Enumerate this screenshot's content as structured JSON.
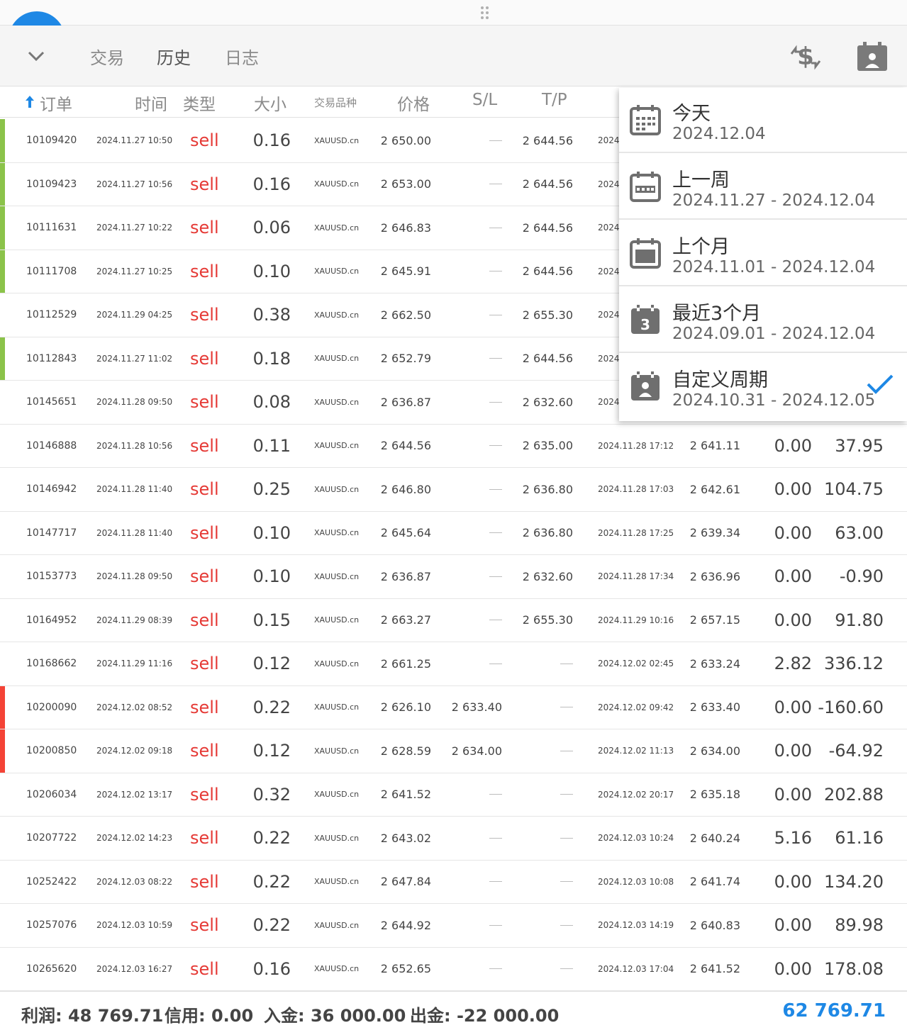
{
  "toolbar": {
    "tabs": [
      "交易",
      "历史",
      "日志"
    ],
    "active_tab": "历史",
    "icons": [
      "chevron-down-icon",
      "currency-exchange-icon",
      "calendar-user-icon"
    ]
  },
  "table": {
    "headers": [
      "订单",
      "时间",
      "类型",
      "大小",
      "交易品种",
      "价格",
      "S/L",
      "T/P"
    ],
    "rows": [
      {
        "order": "10109420",
        "time": "2024.11.27 10:50",
        "type": "sell",
        "size": "0.16",
        "symbol": "XAUUSD.cn",
        "price": "2 650.00",
        "sl": "",
        "tp": "2 644.56",
        "close_time": "2024",
        "close_price": "",
        "swap": "",
        "profit": "",
        "bar": "#8bc34a"
      },
      {
        "order": "10109423",
        "time": "2024.11.27 10:56",
        "type": "sell",
        "size": "0.16",
        "symbol": "XAUUSD.cn",
        "price": "2 653.00",
        "sl": "",
        "tp": "2 644.56",
        "close_time": "2024",
        "close_price": "",
        "swap": "",
        "profit": "",
        "bar": "#8bc34a"
      },
      {
        "order": "10111631",
        "time": "2024.11.27 10:22",
        "type": "sell",
        "size": "0.06",
        "symbol": "XAUUSD.cn",
        "price": "2 646.83",
        "sl": "",
        "tp": "2 644.56",
        "close_time": "2024",
        "close_price": "",
        "swap": "",
        "profit": "",
        "bar": "#8bc34a"
      },
      {
        "order": "10111708",
        "time": "2024.11.27 10:25",
        "type": "sell",
        "size": "0.10",
        "symbol": "XAUUSD.cn",
        "price": "2 645.91",
        "sl": "",
        "tp": "2 644.56",
        "close_time": "2024",
        "close_price": "",
        "swap": "",
        "profit": "",
        "bar": "#8bc34a"
      },
      {
        "order": "10112529",
        "time": "2024.11.29 04:25",
        "type": "sell",
        "size": "0.38",
        "symbol": "XAUUSD.cn",
        "price": "2 662.50",
        "sl": "",
        "tp": "2 655.30",
        "close_time": "2024",
        "close_price": "",
        "swap": "",
        "profit": "",
        "bar": ""
      },
      {
        "order": "10112843",
        "time": "2024.11.27 11:02",
        "type": "sell",
        "size": "0.18",
        "symbol": "XAUUSD.cn",
        "price": "2 652.79",
        "sl": "",
        "tp": "2 644.56",
        "close_time": "2024",
        "close_price": "",
        "swap": "",
        "profit": "",
        "bar": "#8bc34a"
      },
      {
        "order": "10145651",
        "time": "2024.11.28 09:50",
        "type": "sell",
        "size": "0.08",
        "symbol": "XAUUSD.cn",
        "price": "2 636.87",
        "sl": "",
        "tp": "2 632.60",
        "close_time": "2024",
        "close_price": "",
        "swap": "",
        "profit": "",
        "bar": ""
      },
      {
        "order": "10146888",
        "time": "2024.11.28 10:56",
        "type": "sell",
        "size": "0.11",
        "symbol": "XAUUSD.cn",
        "price": "2 644.56",
        "sl": "",
        "tp": "2 635.00",
        "close_time": "2024.11.28 17:12",
        "close_price": "2 641.11",
        "swap": "0.00",
        "profit": "37.95",
        "bar": ""
      },
      {
        "order": "10146942",
        "time": "2024.11.28 11:40",
        "type": "sell",
        "size": "0.25",
        "symbol": "XAUUSD.cn",
        "price": "2 646.80",
        "sl": "",
        "tp": "2 636.80",
        "close_time": "2024.11.28 17:03",
        "close_price": "2 642.61",
        "swap": "0.00",
        "profit": "104.75",
        "bar": ""
      },
      {
        "order": "10147717",
        "time": "2024.11.28 11:40",
        "type": "sell",
        "size": "0.10",
        "symbol": "XAUUSD.cn",
        "price": "2 645.64",
        "sl": "",
        "tp": "2 636.80",
        "close_time": "2024.11.28 17:25",
        "close_price": "2 639.34",
        "swap": "0.00",
        "profit": "63.00",
        "bar": ""
      },
      {
        "order": "10153773",
        "time": "2024.11.28 09:50",
        "type": "sell",
        "size": "0.10",
        "symbol": "XAUUSD.cn",
        "price": "2 636.87",
        "sl": "",
        "tp": "2 632.60",
        "close_time": "2024.11.28 17:34",
        "close_price": "2 636.96",
        "swap": "0.00",
        "profit": "-0.90",
        "bar": ""
      },
      {
        "order": "10164952",
        "time": "2024.11.29 08:39",
        "type": "sell",
        "size": "0.15",
        "symbol": "XAUUSD.cn",
        "price": "2 663.27",
        "sl": "",
        "tp": "2 655.30",
        "close_time": "2024.11.29 10:16",
        "close_price": "2 657.15",
        "swap": "0.00",
        "profit": "91.80",
        "bar": ""
      },
      {
        "order": "10168662",
        "time": "2024.11.29 11:16",
        "type": "sell",
        "size": "0.12",
        "symbol": "XAUUSD.cn",
        "price": "2 661.25",
        "sl": "",
        "tp": "",
        "close_time": "2024.12.02 02:45",
        "close_price": "2 633.24",
        "swap": "2.82",
        "profit": "336.12",
        "bar": ""
      },
      {
        "order": "10200090",
        "time": "2024.12.02 08:52",
        "type": "sell",
        "size": "0.22",
        "symbol": "XAUUSD.cn",
        "price": "2 626.10",
        "sl": "2 633.40",
        "tp": "",
        "close_time": "2024.12.02 09:42",
        "close_price": "2 633.40",
        "swap": "0.00",
        "profit": "-160.60",
        "bar": "#f44336"
      },
      {
        "order": "10200850",
        "time": "2024.12.02 09:18",
        "type": "sell",
        "size": "0.12",
        "symbol": "XAUUSD.cn",
        "price": "2 628.59",
        "sl": "2 634.00",
        "tp": "",
        "close_time": "2024.12.02 11:13",
        "close_price": "2 634.00",
        "swap": "0.00",
        "profit": "-64.92",
        "bar": "#f44336"
      },
      {
        "order": "10206034",
        "time": "2024.12.02 13:17",
        "type": "sell",
        "size": "0.32",
        "symbol": "XAUUSD.cn",
        "price": "2 641.52",
        "sl": "",
        "tp": "",
        "close_time": "2024.12.02 20:17",
        "close_price": "2 635.18",
        "swap": "0.00",
        "profit": "202.88",
        "bar": ""
      },
      {
        "order": "10207722",
        "time": "2024.12.02 14:23",
        "type": "sell",
        "size": "0.22",
        "symbol": "XAUUSD.cn",
        "price": "2 643.02",
        "sl": "",
        "tp": "",
        "close_time": "2024.12.03 10:24",
        "close_price": "2 640.24",
        "swap": "5.16",
        "profit": "61.16",
        "bar": ""
      },
      {
        "order": "10252422",
        "time": "2024.12.03 08:22",
        "type": "sell",
        "size": "0.22",
        "symbol": "XAUUSD.cn",
        "price": "2 647.84",
        "sl": "",
        "tp": "",
        "close_time": "2024.12.03 10:08",
        "close_price": "2 641.74",
        "swap": "0.00",
        "profit": "134.20",
        "bar": ""
      },
      {
        "order": "10257076",
        "time": "2024.12.03 10:59",
        "type": "sell",
        "size": "0.22",
        "symbol": "XAUUSD.cn",
        "price": "2 644.92",
        "sl": "",
        "tp": "",
        "close_time": "2024.12.03 14:19",
        "close_price": "2 640.83",
        "swap": "0.00",
        "profit": "89.98",
        "bar": ""
      },
      {
        "order": "10265620",
        "time": "2024.12.03 16:27",
        "type": "sell",
        "size": "0.16",
        "symbol": "XAUUSD.cn",
        "price": "2 652.65",
        "sl": "",
        "tp": "",
        "close_time": "2024.12.03 17:04",
        "close_price": "2 641.52",
        "swap": "0.00",
        "profit": "178.08",
        "bar": ""
      }
    ]
  },
  "footer": {
    "profit": "利润: 48 769.71",
    "credit": "信用: 0.00",
    "deposit": "入金: 36 000.00",
    "withdrawal": "出金: -22 000.00",
    "balance": "62 769.71"
  },
  "period_menu": {
    "items": [
      {
        "title": "今天",
        "range": "2024.12.04",
        "icon": "calendar-grid-icon",
        "selected": false
      },
      {
        "title": "上一周",
        "range": "2024.11.27 - 2024.12.04",
        "icon": "calendar-week-icon",
        "selected": false
      },
      {
        "title": "上个月",
        "range": "2024.11.01 - 2024.12.04",
        "icon": "calendar-month-icon",
        "selected": false
      },
      {
        "title": "最近3个月",
        "range": "2024.09.01 - 2024.12.04",
        "icon": "calendar-3-icon",
        "icon_text": "3",
        "selected": false
      },
      {
        "title": "自定义周期",
        "range": "2024.10.31 - 2024.12.05",
        "icon": "calendar-custom-icon",
        "selected": true
      }
    ]
  },
  "colors": {
    "accent": "#1e88e5",
    "sell": "#e53935",
    "profit_bar": "#8bc34a",
    "loss_bar": "#f44336"
  }
}
